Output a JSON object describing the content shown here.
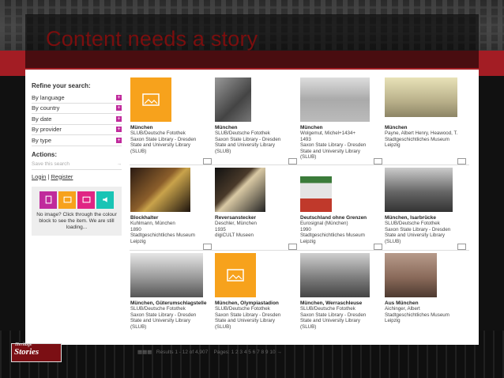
{
  "slide": {
    "title": "Content needs a story",
    "logo_text": "Stories",
    "logo_top": "Heritage"
  },
  "sidebar": {
    "refine_heading": "Refine your search:",
    "facets": [
      "By language",
      "By country",
      "By date",
      "By provider",
      "By type"
    ],
    "actions_heading": "Actions:",
    "save_search": "Save this search",
    "login": "Login",
    "register": "Register",
    "legend": "No image? Click through the colour block to see the item. We are still loading..."
  },
  "results": [
    {
      "title": "München",
      "desc": [
        "SLUB/Deutsche Fotothek",
        "Saxon State Library - Dresden",
        "State and University Library",
        "(SLUB)"
      ]
    },
    {
      "title": "München",
      "desc": [
        "SLUB/Deutsche Fotothek",
        "Saxon State Library - Dresden",
        "State and University Library",
        "(SLUB)"
      ]
    },
    {
      "title": "München",
      "desc": [
        "Wolgemut, Michel+1434+",
        "1493",
        "Saxon State Library - Dresden",
        "State and University Library",
        "(SLUB)"
      ]
    },
    {
      "title": "München",
      "desc": [
        "Payne, Albert Henry, Heawood, T.",
        "Stadtgeschichtliches Museum",
        "Leipzig"
      ]
    },
    {
      "title": "Blockhalter",
      "desc": [
        "Kuhlmann, München",
        "1890",
        "Stadtgeschichtliches Museum",
        "Leipzig"
      ]
    },
    {
      "title": "Reversanstecker",
      "desc": [
        "Deschler, München",
        "1935",
        "digiCULT Museen"
      ]
    },
    {
      "title": "Deutschland ohne Grenzen",
      "desc": [
        "Eurosignal (München)",
        "1990",
        "Stadtgeschichtliches Museum",
        "Leipzig"
      ]
    },
    {
      "title": "München, Isarbrücke",
      "desc": [
        "SLUB/Deutsche Fotothek",
        "Saxon State Library - Dresden",
        "State and University Library",
        "(SLUB)"
      ]
    },
    {
      "title": "München, Güterumschlagstelle",
      "desc": [
        "SLUB/Deutsche Fotothek",
        "Saxon State Library - Dresden",
        "State and University Library",
        "(SLUB)"
      ]
    },
    {
      "title": "München, Olympiastadion",
      "desc": [
        "SLUB/Deutsche Fotothek",
        "Saxon State Library - Dresden",
        "State and University Library",
        "(SLUB)"
      ]
    },
    {
      "title": "München, Werraschleuse",
      "desc": [
        "SLUB/Deutsche Fotothek",
        "Saxon State Library - Dresden",
        "State and University Library",
        "(SLUB)"
      ]
    },
    {
      "title": "Aus München",
      "desc": [
        "Aichinger, Albert",
        "Stadtgeschichtliches Museum",
        "Leipzig"
      ]
    }
  ],
  "pager": {
    "text": "Results 1 - 12 of 4,907",
    "pages_label": "Pages:",
    "pages": "1 2 3 4 5 6 7 8 9 10"
  },
  "colors": {
    "orange": "#f7a21c",
    "pink": "#c02a9c",
    "magenta": "#e02584",
    "teal": "#19c4b5",
    "red": "#a31d24"
  }
}
